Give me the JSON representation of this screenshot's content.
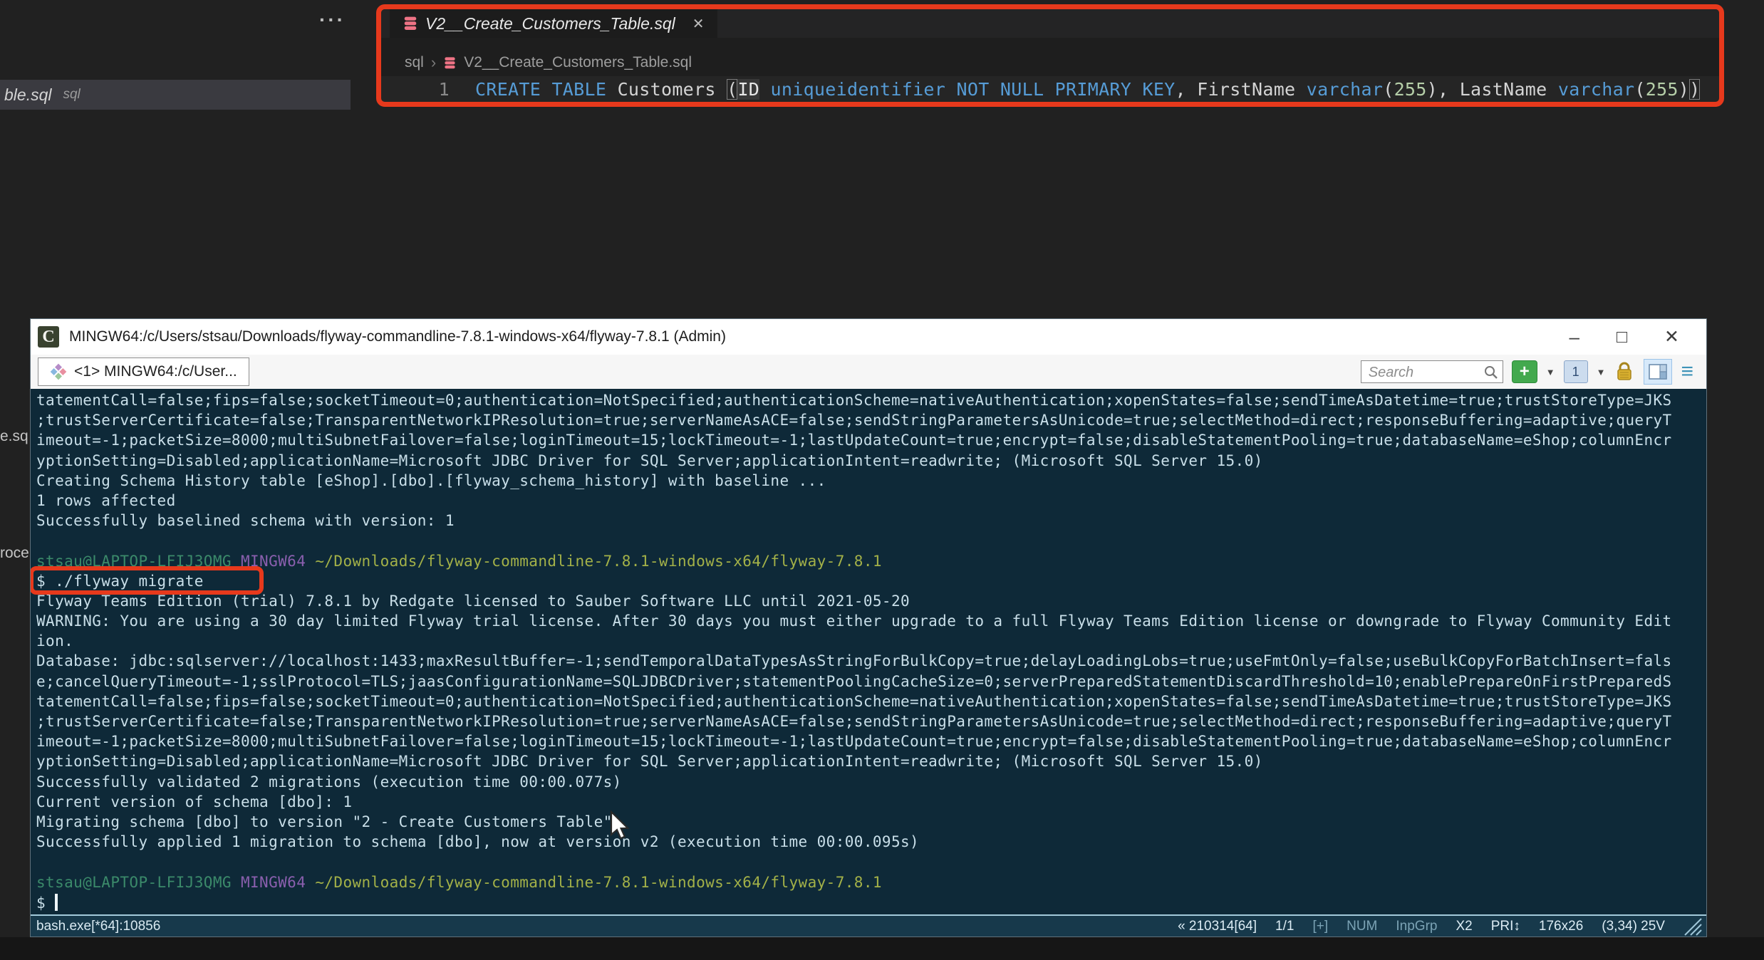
{
  "editor": {
    "more_actions": "···",
    "background_tab": {
      "filename": "ble.sql",
      "language": "sql"
    },
    "clipped_fragments": [
      "e.sq",
      "roce"
    ],
    "tab": {
      "filename": "V2__Create_Customers_Table.sql",
      "close_glyph": "✕"
    },
    "breadcrumb": {
      "folder": "sql",
      "chevron": "›",
      "file": "V2__Create_Customers_Table.sql"
    },
    "code": {
      "line_number": "1",
      "full_text": "CREATE TABLE Customers (ID uniqueidentifier NOT NULL PRIMARY KEY, FirstName varchar(255), LastName varchar(255))",
      "tokens": [
        {
          "t": "CREATE TABLE",
          "c": "kw"
        },
        {
          "t": " Customers ",
          "c": "pl"
        },
        {
          "t": "(",
          "c": "br"
        },
        {
          "t": "ID",
          "c": "idhl"
        },
        {
          "t": " ",
          "c": "pl"
        },
        {
          "t": "uniqueidentifier",
          "c": "kw"
        },
        {
          "t": " ",
          "c": "pl"
        },
        {
          "t": "NOT NULL PRIMARY KEY",
          "c": "kw"
        },
        {
          "t": ", FirstName ",
          "c": "pl"
        },
        {
          "t": "varchar",
          "c": "kw"
        },
        {
          "t": "(",
          "c": "pl"
        },
        {
          "t": "255",
          "c": "num"
        },
        {
          "t": ")",
          "c": "pl"
        },
        {
          "t": ", LastName ",
          "c": "pl"
        },
        {
          "t": "varchar",
          "c": "kw"
        },
        {
          "t": "(",
          "c": "pl"
        },
        {
          "t": "255",
          "c": "num"
        },
        {
          "t": ")",
          "c": "pl"
        },
        {
          "t": ")",
          "c": "br"
        }
      ]
    }
  },
  "terminal": {
    "title": "MINGW64:/c/Users/stsau/Downloads/flyway-commandline-7.8.1-windows-x64/flyway-7.8.1 (Admin)",
    "app_icon_letter": "C",
    "controls": {
      "minimize": "–",
      "maximize": "□",
      "close": "✕"
    },
    "tab_label": "<1> MINGW64:/c/User...",
    "search_placeholder": "Search",
    "new_console_label": "+",
    "active_console_number": "1",
    "dropdown_glyph": "▼",
    "menu_glyph": "≡",
    "lines": [
      {
        "seg": [
          {
            "t": "tatementCall=false;fips=false;socketTimeout=0;authentication=NotSpecified;authenticationScheme=nativeAuthentication;xopenStates=false;sendTimeAsDatetime=true;trustStoreType=JKS",
            "c": "fg"
          }
        ]
      },
      {
        "seg": [
          {
            "t": ";trustServerCertificate=false;TransparentNetworkIPResolution=true;serverNameAsACE=false;sendStringParametersAsUnicode=true;selectMethod=direct;responseBuffering=adaptive;queryT",
            "c": "fg"
          }
        ]
      },
      {
        "seg": [
          {
            "t": "imeout=-1;packetSize=8000;multiSubnetFailover=false;loginTimeout=15;lockTimeout=-1;lastUpdateCount=true;encrypt=false;disableStatementPooling=true;databaseName=eShop;columnEncr",
            "c": "fg"
          }
        ]
      },
      {
        "seg": [
          {
            "t": "yptionSetting=Disabled;applicationName=Microsoft JDBC Driver for SQL Server;applicationIntent=readwrite; (Microsoft SQL Server 15.0)",
            "c": "fg"
          }
        ]
      },
      {
        "seg": [
          {
            "t": "Creating Schema History table [eShop].[dbo].[flyway_schema_history] with baseline ...",
            "c": "fg"
          }
        ]
      },
      {
        "seg": [
          {
            "t": "1 rows affected",
            "c": "fg"
          }
        ]
      },
      {
        "seg": [
          {
            "t": "Successfully baselined schema with version: 1",
            "c": "fg"
          }
        ]
      },
      {
        "seg": [
          {
            "t": "",
            "c": "fg"
          }
        ]
      },
      {
        "seg": [
          {
            "t": "stsau@LAPTOP-LFIJ3QMG",
            "c": "green"
          },
          {
            "t": " ",
            "c": "fg"
          },
          {
            "t": "MINGW64",
            "c": "purple"
          },
          {
            "t": " ",
            "c": "fg"
          },
          {
            "t": "~/Downloads/flyway-commandline-7.8.1-windows-x64/flyway-7.8.1",
            "c": "yellow"
          }
        ]
      },
      {
        "boxed": true,
        "seg": [
          {
            "t": "$ ./flyway migrate",
            "c": "fg"
          }
        ]
      },
      {
        "seg": [
          {
            "t": "Flyway Teams Edition (trial) 7.8.1 by Redgate licensed to Sauber Software LLC until 2021-05-20",
            "c": "fg"
          }
        ]
      },
      {
        "seg": [
          {
            "t": "WARNING: You are using a 30 day limited Flyway trial license. After 30 days you must either upgrade to a full Flyway Teams Edition license or downgrade to Flyway Community Edit",
            "c": "fg"
          }
        ]
      },
      {
        "seg": [
          {
            "t": "ion.",
            "c": "fg"
          }
        ]
      },
      {
        "seg": [
          {
            "t": "Database: jdbc:sqlserver://localhost:1433;maxResultBuffer=-1;sendTemporalDataTypesAsStringForBulkCopy=true;delayLoadingLobs=true;useFmtOnly=false;useBulkCopyForBatchInsert=fals",
            "c": "fg"
          }
        ]
      },
      {
        "seg": [
          {
            "t": "e;cancelQueryTimeout=-1;sslProtocol=TLS;jaasConfigurationName=SQLJDBCDriver;statementPoolingCacheSize=0;serverPreparedStatementDiscardThreshold=10;enablePrepareOnFirstPreparedS",
            "c": "fg"
          }
        ]
      },
      {
        "seg": [
          {
            "t": "tatementCall=false;fips=false;socketTimeout=0;authentication=NotSpecified;authenticationScheme=nativeAuthentication;xopenStates=false;sendTimeAsDatetime=true;trustStoreType=JKS",
            "c": "fg"
          }
        ]
      },
      {
        "seg": [
          {
            "t": ";trustServerCertificate=false;TransparentNetworkIPResolution=true;serverNameAsACE=false;sendStringParametersAsUnicode=true;selectMethod=direct;responseBuffering=adaptive;queryT",
            "c": "fg"
          }
        ]
      },
      {
        "seg": [
          {
            "t": "imeout=-1;packetSize=8000;multiSubnetFailover=false;loginTimeout=15;lockTimeout=-1;lastUpdateCount=true;encrypt=false;disableStatementPooling=true;databaseName=eShop;columnEncr",
            "c": "fg"
          }
        ]
      },
      {
        "seg": [
          {
            "t": "yptionSetting=Disabled;applicationName=Microsoft JDBC Driver for SQL Server;applicationIntent=readwrite; (Microsoft SQL Server 15.0)",
            "c": "fg"
          }
        ]
      },
      {
        "seg": [
          {
            "t": "Successfully validated 2 migrations (execution time 00:00.077s)",
            "c": "fg"
          }
        ]
      },
      {
        "seg": [
          {
            "t": "Current version of schema [dbo]: 1",
            "c": "fg"
          }
        ]
      },
      {
        "seg": [
          {
            "t": "Migrating schema [dbo] to version \"2 - Create Customers Table\"",
            "c": "fg"
          }
        ]
      },
      {
        "seg": [
          {
            "t": "Successfully applied 1 migration to schema [dbo], now at version v2 (execution time 00:00.095s)",
            "c": "fg"
          }
        ]
      },
      {
        "seg": [
          {
            "t": "",
            "c": "fg"
          }
        ]
      },
      {
        "seg": [
          {
            "t": "stsau@LAPTOP-LFIJ3QMG",
            "c": "green"
          },
          {
            "t": " ",
            "c": "fg"
          },
          {
            "t": "MINGW64",
            "c": "purple"
          },
          {
            "t": " ",
            "c": "fg"
          },
          {
            "t": "~/Downloads/flyway-commandline-7.8.1-windows-x64/flyway-7.8.1",
            "c": "yellow"
          }
        ]
      },
      {
        "cursor": true,
        "seg": [
          {
            "t": "$ ",
            "c": "fg"
          }
        ]
      }
    ],
    "statusbar": {
      "left": "bash.exe[*64]:10856",
      "right_segments": [
        {
          "t": "« 210314[64]",
          "c": "bright"
        },
        {
          "t": "1/1",
          "c": "bright"
        },
        {
          "t": "[+]",
          "c": "dim"
        },
        {
          "t": "NUM",
          "c": "dim"
        },
        {
          "t": "InpGrp",
          "c": "dim"
        },
        {
          "t": "X2",
          "c": "bright"
        },
        {
          "t": "PRI↕",
          "c": "bright"
        },
        {
          "t": "176x26",
          "c": "bright"
        },
        {
          "t": "(3,34) 25V",
          "c": "bright"
        }
      ]
    }
  },
  "colors": {
    "annotation_red": "#e7391c",
    "terminal_bg": "#0e2938",
    "terminal_fg": "#c9dfe9",
    "prompt_green": "#3b8a6a",
    "prompt_purple": "#8a5fae",
    "prompt_yellow": "#a3b148",
    "keyword_blue": "#569cd6",
    "editor_bg": "#1e1e1e"
  }
}
